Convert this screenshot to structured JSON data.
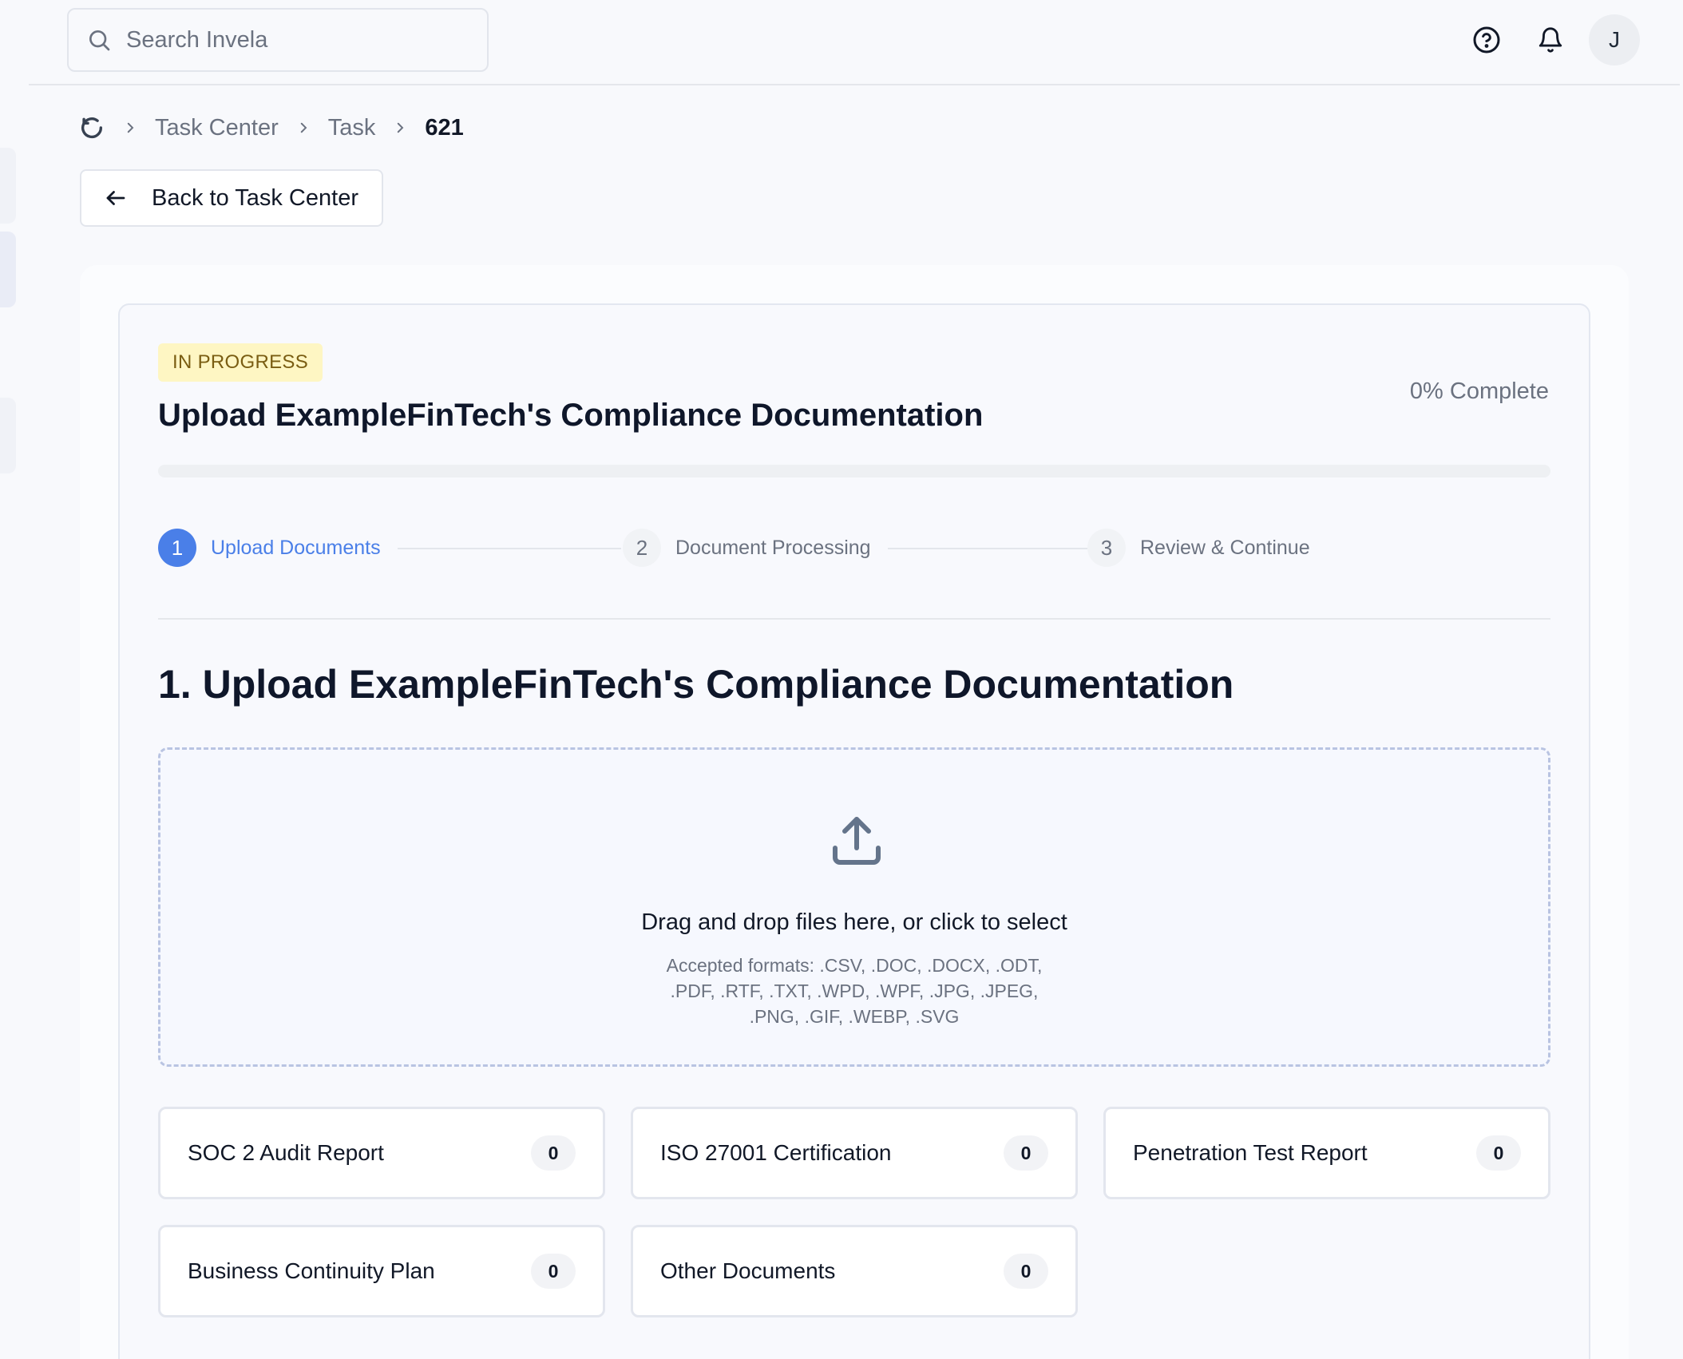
{
  "search": {
    "placeholder": "Search Invela"
  },
  "header": {
    "avatar_initial": "J"
  },
  "breadcrumb": {
    "items": [
      "Task Center",
      "Task"
    ],
    "current": "621"
  },
  "back_button": {
    "label": "Back to Task Center"
  },
  "task": {
    "status": "IN PROGRESS",
    "title": "Upload ExampleFinTech's Compliance Documentation",
    "progress_text": "0% Complete",
    "progress_fraction": 0
  },
  "stepper": {
    "steps": [
      {
        "number": "1",
        "label": "Upload Documents",
        "state": "active"
      },
      {
        "number": "2",
        "label": "Document Processing",
        "state": "pending"
      },
      {
        "number": "3",
        "label": "Review & Continue",
        "state": "pending"
      }
    ]
  },
  "section": {
    "title": "1. Upload ExampleFinTech's Compliance Documentation"
  },
  "dropzone": {
    "title": "Drag and drop files here, or click to select",
    "formats": "Accepted formats: .CSV, .DOC, .DOCX, .ODT, .PDF, .RTF, .TXT, .WPD, .WPF, .JPG, .JPEG, .PNG, .GIF, .WEBP, .SVG"
  },
  "categories": [
    {
      "label": "SOC 2 Audit Report",
      "count": "0"
    },
    {
      "label": "ISO 27001 Certification",
      "count": "0"
    },
    {
      "label": "Penetration Test Report",
      "count": "0"
    },
    {
      "label": "Business Continuity Plan",
      "count": "0"
    },
    {
      "label": "Other Documents",
      "count": "0"
    }
  ],
  "colors": {
    "accent": "#4a7fe8",
    "badge_bg": "#fef6c3",
    "badge_text": "#7a5d12"
  },
  "icons": [
    "search-icon",
    "help-icon",
    "bell-icon",
    "home-icon",
    "chevron-right-icon",
    "arrow-left-icon",
    "upload-icon"
  ]
}
